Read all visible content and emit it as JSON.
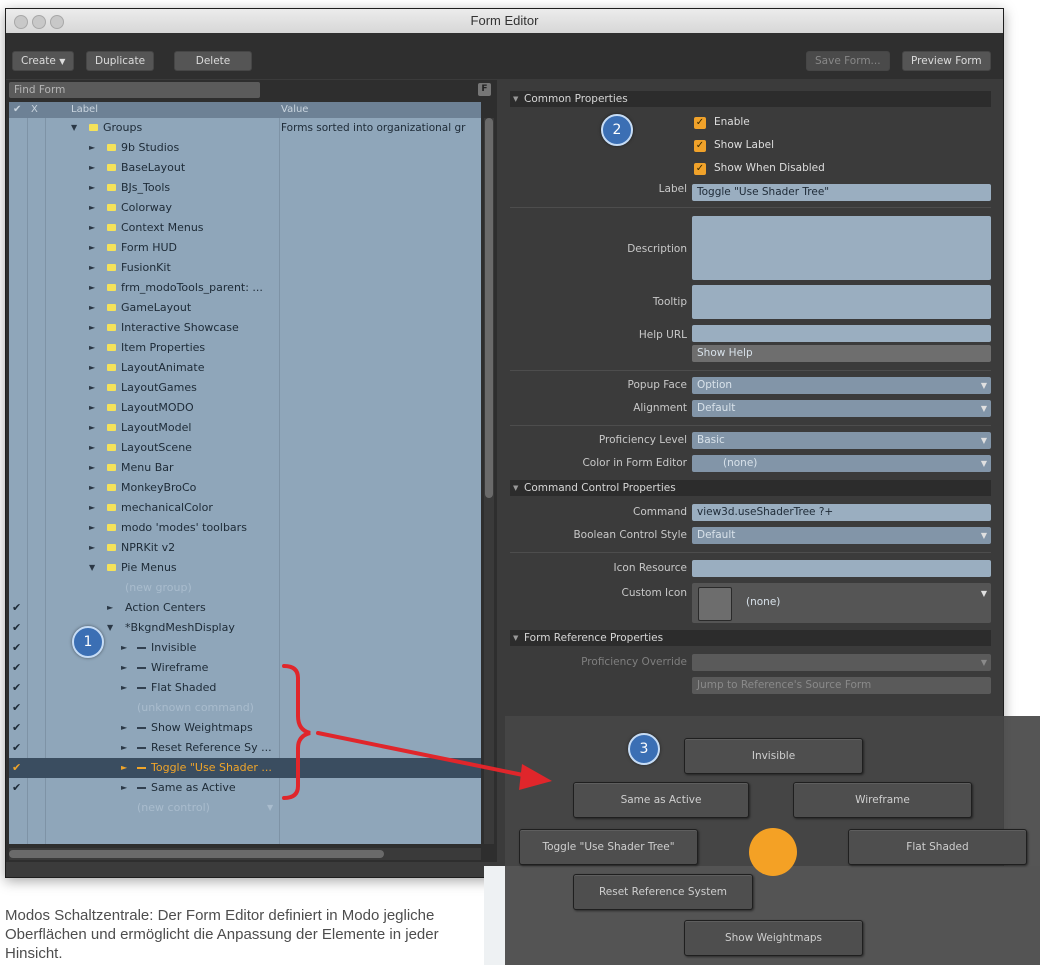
{
  "window": {
    "title": "Form Editor"
  },
  "toolbar": {
    "create_label": "Create",
    "duplicate_label": "Duplicate",
    "delete_label": "Delete",
    "save_form_label": "Save Form...",
    "preview_form_label": "Preview Form"
  },
  "tree": {
    "find_placeholder": "Find Form",
    "filter_label": "F",
    "columns": {
      "check": "✔",
      "x": "X",
      "label": "Label",
      "value": "Value"
    },
    "rows": [
      {
        "label": "Groups",
        "value": "Forms sorted into organizational gr"
      },
      {
        "label": "9b Studios"
      },
      {
        "label": "BaseLayout"
      },
      {
        "label": "BJs_Tools"
      },
      {
        "label": "Colorway"
      },
      {
        "label": "Context Menus"
      },
      {
        "label": "Form HUD"
      },
      {
        "label": "FusionKit"
      },
      {
        "label": "frm_modoTools_parent: ..."
      },
      {
        "label": "GameLayout"
      },
      {
        "label": "Interactive Showcase"
      },
      {
        "label": "Item Properties"
      },
      {
        "label": "LayoutAnimate"
      },
      {
        "label": "LayoutGames"
      },
      {
        "label": "LayoutMODO"
      },
      {
        "label": "LayoutModel"
      },
      {
        "label": "LayoutScene"
      },
      {
        "label": "Menu Bar"
      },
      {
        "label": "MonkeyBroCo"
      },
      {
        "label": "mechanicalColor"
      },
      {
        "label": "modo 'modes' toolbars"
      },
      {
        "label": "NPRKit v2"
      },
      {
        "label": "Pie Menus"
      },
      {
        "label": "(new group)"
      },
      {
        "label": "Action Centers"
      },
      {
        "label": "*BkgndMeshDisplay"
      },
      {
        "label": "Invisible"
      },
      {
        "label": "Wireframe"
      },
      {
        "label": "Flat Shaded"
      },
      {
        "label": "(unknown command)"
      },
      {
        "label": "Show Weightmaps"
      },
      {
        "label": "Reset Reference Sy ..."
      },
      {
        "label": "Toggle \"Use Shader ..."
      },
      {
        "label": "Same as Active"
      },
      {
        "label": "(new control)"
      }
    ]
  },
  "props": {
    "common_header": "Common Properties",
    "enable_label": "Enable",
    "show_label_label": "Show Label",
    "show_when_disabled_label": "Show When Disabled",
    "label_label": "Label",
    "label_value": "Toggle \"Use Shader Tree\"",
    "description_label": "Description",
    "tooltip_label": "Tooltip",
    "help_url_label": "Help URL",
    "show_help_label": "Show Help",
    "popup_face_label": "Popup Face",
    "popup_face_value": "Option",
    "alignment_label": "Alignment",
    "alignment_value": "Default",
    "proficiency_label": "Proficiency Level",
    "proficiency_value": "Basic",
    "color_label": "Color in Form Editor",
    "color_value": "(none)",
    "command_header": "Command Control Properties",
    "command_label": "Command",
    "command_value": "view3d.useShaderTree ?+",
    "boolean_label": "Boolean Control Style",
    "boolean_value": "Default",
    "icon_resource_label": "Icon Resource",
    "custom_icon_label": "Custom Icon",
    "custom_icon_value": "(none)",
    "reference_header": "Form Reference Properties",
    "proficiency_override_label": "Proficiency Override",
    "jump_label": "Jump to Reference's Source Form"
  },
  "preview": {
    "invisible": "Invisible",
    "same_as_active": "Same as Active",
    "wireframe": "Wireframe",
    "toggle_shader": "Toggle \"Use Shader Tree\"",
    "flat_shaded": "Flat Shaded",
    "reset_reference": "Reset Reference System",
    "show_weightmaps": "Show Weightmaps"
  },
  "annotations": {
    "badge1": "1",
    "badge2": "2",
    "badge3": "3"
  },
  "caption": "Modos Schaltzentrale: Der Form Editor definiert in Modo jegliche Oberflächen und ermöglicht die Anpassung der Elemente in jeder Hinsicht.",
  "colors": {
    "accent": "#f4a125",
    "badge": "#3b6fb4",
    "arrow": "#e0262b"
  }
}
